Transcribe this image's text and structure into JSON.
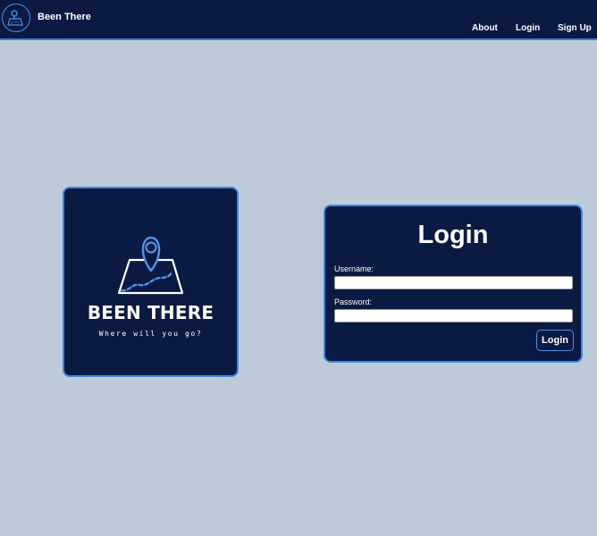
{
  "nav": {
    "brand": "Been There",
    "links": [
      {
        "label": "About"
      },
      {
        "label": "Login"
      },
      {
        "label": "Sign Up"
      }
    ],
    "logo_icon": "map-pin-icon"
  },
  "logo_card": {
    "title": "BEEN THERE",
    "tagline": "Where will you go?",
    "graphic_icon": "map-with-pin-icon"
  },
  "login_form": {
    "title": "Login",
    "username_label": "Username:",
    "username_value": "",
    "password_label": "Password:",
    "password_value": "",
    "submit_label": "Login"
  },
  "colors": {
    "page_background": "#bccbd7",
    "navy": "#0b1a42",
    "accent_blue": "#3f84e6"
  }
}
